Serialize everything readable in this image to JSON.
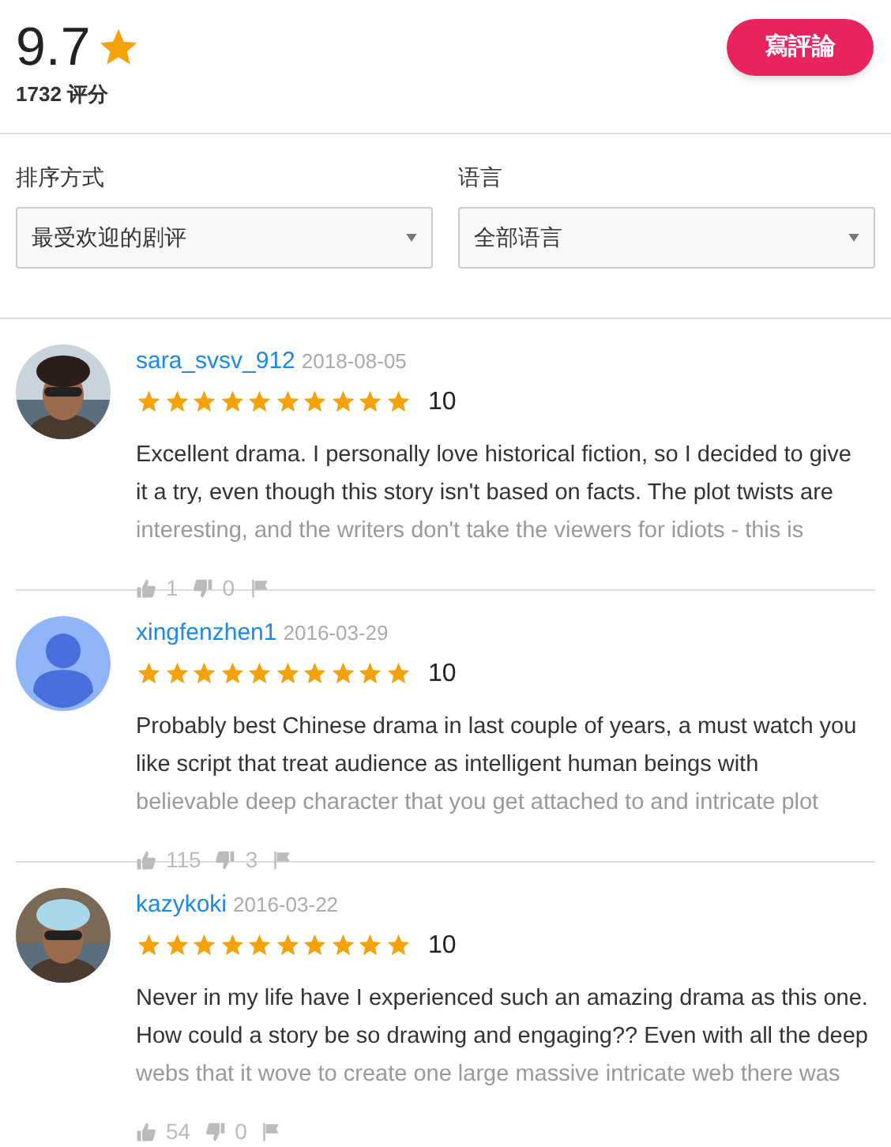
{
  "rating": {
    "score": "9.7",
    "count": "1732 评分"
  },
  "write_button": "寫評論",
  "filters": [
    {
      "label": "排序方式",
      "value": "最受欢迎的剧评"
    },
    {
      "label": "语言",
      "value": "全部语言"
    }
  ],
  "reviews": [
    {
      "avatar": {
        "kind": "picture"
      },
      "user": "sara_svsv_912",
      "date": "2018-08-05",
      "stars": 10,
      "score": "10",
      "lines": [
        "Excellent drama. I personally love historical fiction, so I decided to give",
        "it a try, even though this story isn't based on facts. The plot twists are"
      ],
      "faded_line": "interesting, and the writers don't take the viewers for idiots - this is",
      "likes": "1",
      "dislikes": "0"
    },
    {
      "avatar": {
        "kind": "default"
      },
      "user": "xingfenzhen1",
      "date": "2016-03-29",
      "stars": 10,
      "score": "10",
      "lines": [
        "Probably best Chinese drama in last couple of years, a must watch you",
        "like script that treat audience as intelligent human beings with"
      ],
      "faded_line": "believable deep character that you get attached to and intricate plot",
      "likes": "115",
      "dislikes": "3"
    },
    {
      "avatar": {
        "kind": "picture"
      },
      "user": "kazykoki",
      "date": "2016-03-22",
      "stars": 10,
      "score": "10",
      "lines": [
        "Never in my life have I experienced such an amazing drama as this one.",
        "How could a story be so drawing and engaging?? Even with all the deep"
      ],
      "faded_line": "webs that it wove to create one large massive intricate web there was",
      "likes": "54",
      "dislikes": "0"
    }
  ]
}
